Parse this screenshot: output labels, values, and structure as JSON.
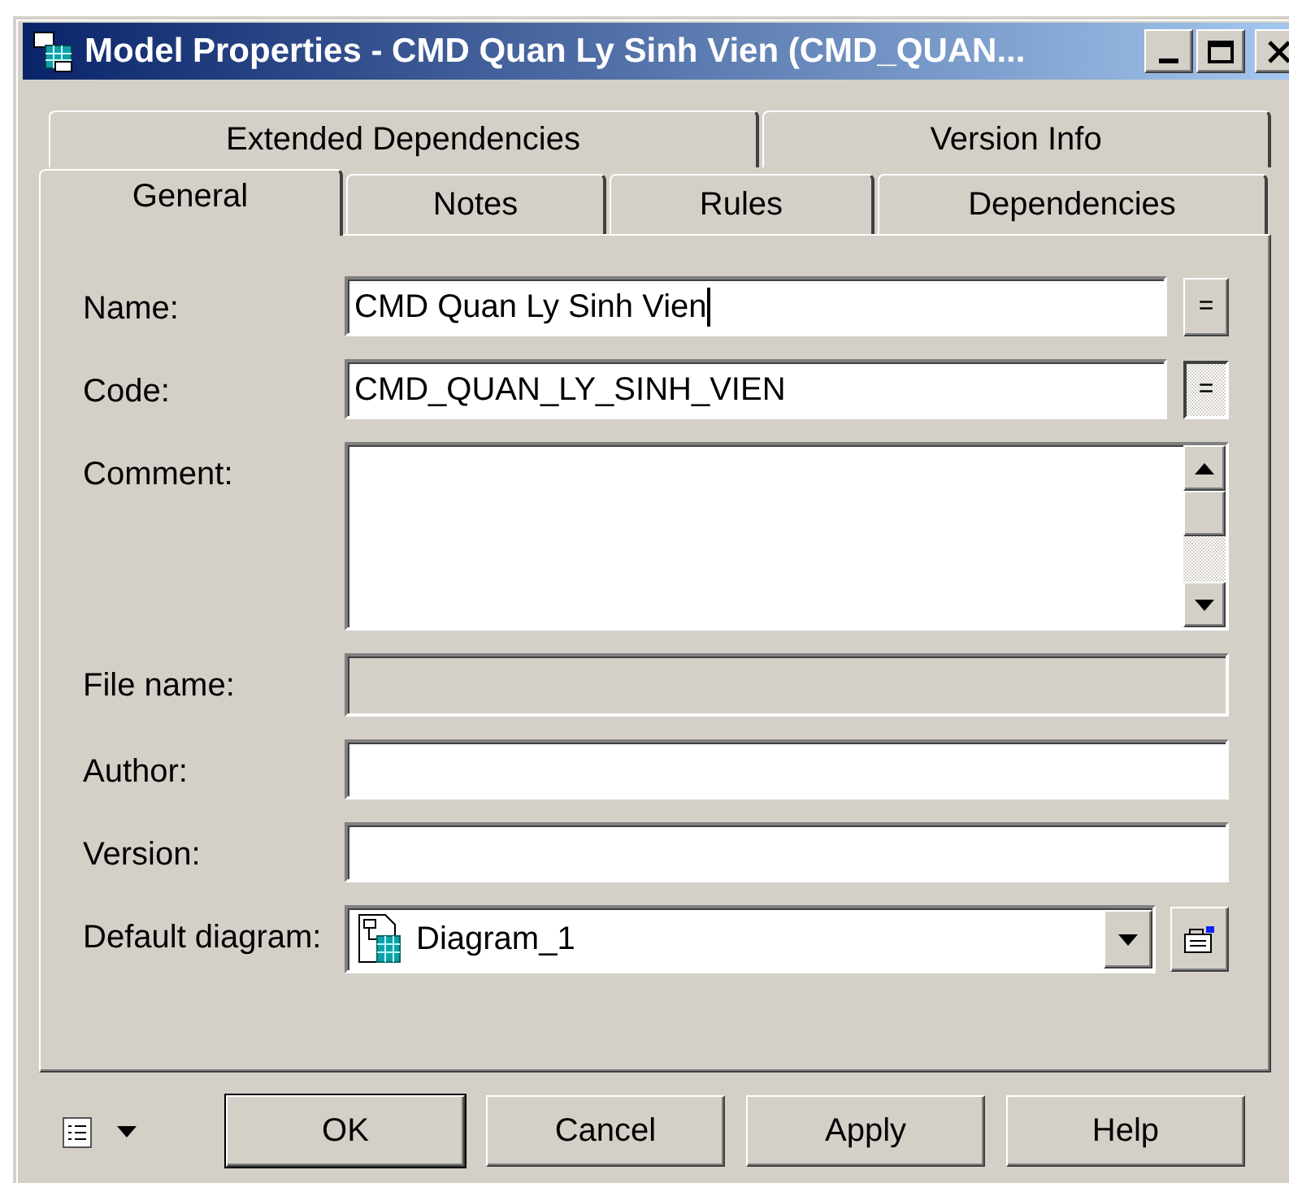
{
  "window": {
    "title": "Model Properties - CMD Quan Ly Sinh Vien (CMD_QUAN..."
  },
  "tab_rows": [
    [
      {
        "label": "Extended Dependencies",
        "selected": false
      },
      {
        "label": "Version Info",
        "selected": false
      }
    ],
    [
      {
        "label": "General",
        "selected": true
      },
      {
        "label": "Notes",
        "selected": false
      },
      {
        "label": "Rules",
        "selected": false
      },
      {
        "label": "Dependencies",
        "selected": false
      }
    ]
  ],
  "fields": [
    {
      "kind": "text",
      "label": "Name:",
      "value": "CMD Quan Ly Sinh Vien",
      "focused": true,
      "disabled": false,
      "equals_button": {
        "label": "=",
        "pressed": false
      }
    },
    {
      "kind": "text",
      "label": "Code:",
      "value": "CMD_QUAN_LY_SINH_VIEN",
      "disabled": false,
      "equals_button": {
        "label": "=",
        "pressed": true
      }
    },
    {
      "kind": "textarea",
      "label": "Comment:",
      "disabled": false
    },
    {
      "kind": "text",
      "label": "File name:",
      "disabled": true
    },
    {
      "kind": "text",
      "label": "Author:",
      "disabled": false
    },
    {
      "kind": "text",
      "label": "Version:",
      "disabled": false
    },
    {
      "kind": "combo",
      "label": "Default diagram:",
      "value": "Diagram_1",
      "disabled": false
    }
  ],
  "buttons": [
    {
      "label": "OK",
      "default": true
    },
    {
      "label": "Cancel",
      "default": false
    },
    {
      "label": "Apply",
      "default": false
    },
    {
      "label": "Help",
      "default": false
    }
  ]
}
